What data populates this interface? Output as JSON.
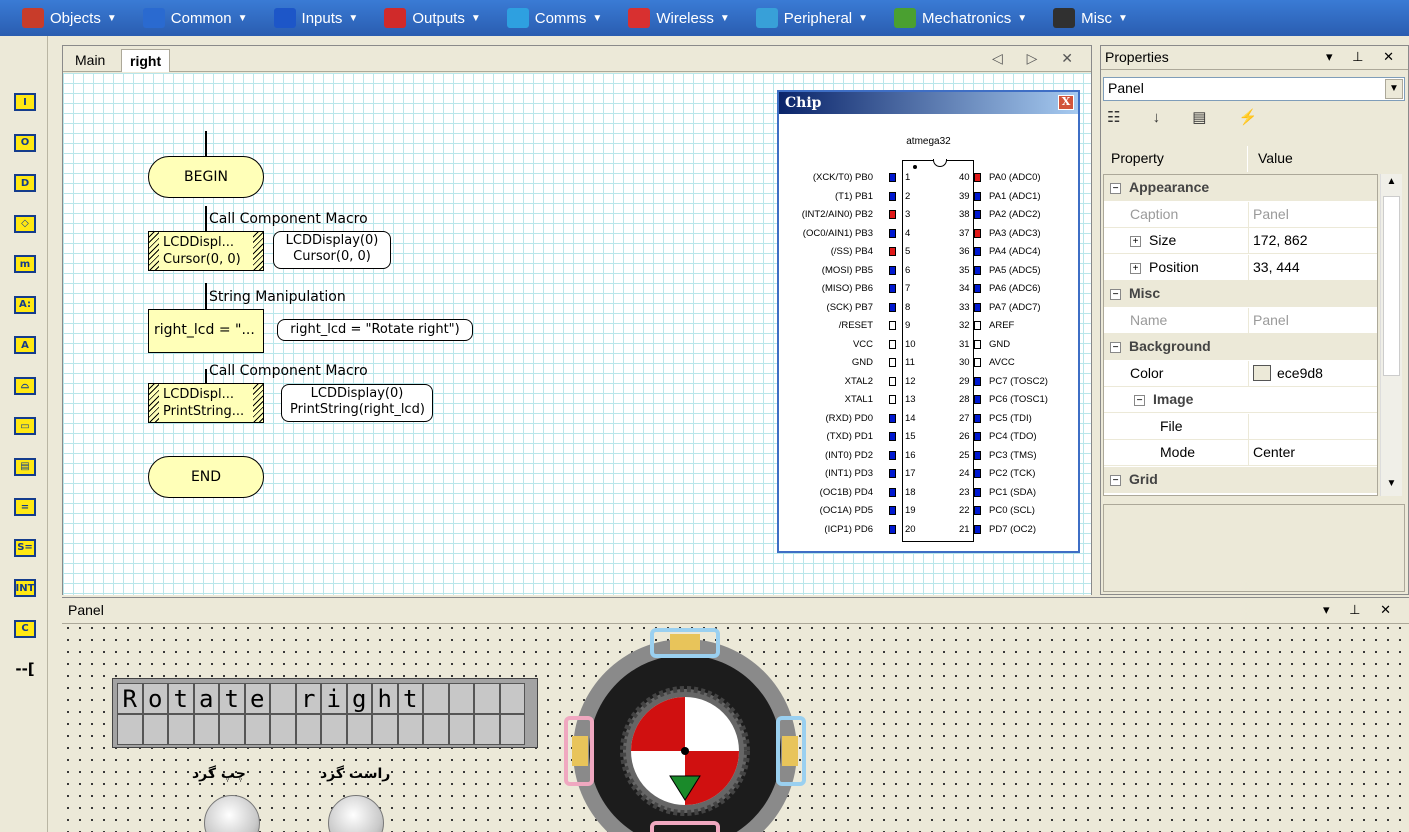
{
  "topbar": {
    "items": [
      {
        "label": "Objects",
        "icon": "objects-icon",
        "color": "#c83c2a"
      },
      {
        "label": "Common",
        "icon": "common-icon",
        "color": "#2a6ad0"
      },
      {
        "label": "Inputs",
        "icon": "inputs-icon",
        "color": "#1d56c8"
      },
      {
        "label": "Outputs",
        "icon": "outputs-icon",
        "color": "#d02a2a"
      },
      {
        "label": "Comms",
        "icon": "comms-icon",
        "color": "#2ea0e0"
      },
      {
        "label": "Wireless",
        "icon": "wireless-icon",
        "color": "#d83030"
      },
      {
        "label": "Peripheral",
        "icon": "peripheral-icon",
        "color": "#38a0d8"
      },
      {
        "label": "Mechatronics",
        "icon": "mechatronics-icon",
        "color": "#4aa030"
      },
      {
        "label": "Misc",
        "icon": "misc-icon",
        "color": "#303030"
      }
    ]
  },
  "toolbox": {
    "items": [
      {
        "name": "input-tool",
        "glyph": "I"
      },
      {
        "name": "output-tool",
        "glyph": "O"
      },
      {
        "name": "delay-tool",
        "glyph": "D"
      },
      {
        "name": "decision-tool",
        "glyph": "◇"
      },
      {
        "name": "switch-tool",
        "glyph": "m"
      },
      {
        "name": "connection-point-tool",
        "glyph": "A:"
      },
      {
        "name": "jump-tool",
        "glyph": "A"
      },
      {
        "name": "loop-tool",
        "glyph": "⌓"
      },
      {
        "name": "macro-tool",
        "glyph": "▭"
      },
      {
        "name": "component-macro-tool",
        "glyph": "▤"
      },
      {
        "name": "calculation-tool",
        "glyph": "="
      },
      {
        "name": "string-tool",
        "glyph": "S="
      },
      {
        "name": "interrupt-tool",
        "glyph": "INT"
      },
      {
        "name": "c-code-tool",
        "glyph": "C"
      },
      {
        "name": "comment-tool",
        "glyph": "--["
      }
    ]
  },
  "doc": {
    "tabs": [
      "Main",
      "right"
    ],
    "active_tab": "right",
    "nav": "◁ ▷ ✕"
  },
  "flow": {
    "begin": "BEGIN",
    "end": "END",
    "label1": "Call Component Macro",
    "macro1_line1": "LCDDispl...",
    "macro1_line2": "Cursor(0, 0)",
    "bubble1_line1": "LCDDisplay(0)",
    "bubble1_line2": "Cursor(0, 0)",
    "label2": "String Manipulation",
    "calc": "right_lcd = \"...",
    "bubble2": "right_lcd = \"Rotate right\")",
    "label3": "Call Component Macro",
    "macro2_line1": "LCDDispl...",
    "macro2_line2": "PrintString...",
    "bubble3_line1": "LCDDisplay(0)",
    "bubble3_line2": "PrintString(right_lcd)"
  },
  "chip": {
    "title": "Chip",
    "close": "X",
    "name": "atmega32",
    "left_pins": [
      {
        "n": "1",
        "label": "(XCK/T0) PB0",
        "color": "#0018d0"
      },
      {
        "n": "2",
        "label": "(T1) PB1",
        "color": "#0018d0"
      },
      {
        "n": "3",
        "label": "(INT2/AIN0) PB2",
        "color": "#e01818"
      },
      {
        "n": "4",
        "label": "(OC0/AIN1) PB3",
        "color": "#0018d0"
      },
      {
        "n": "5",
        "label": "(/SS) PB4",
        "color": "#e01818"
      },
      {
        "n": "6",
        "label": "(MOSI) PB5",
        "color": "#0018d0"
      },
      {
        "n": "7",
        "label": "(MISO) PB6",
        "color": "#0018d0"
      },
      {
        "n": "8",
        "label": "(SCK) PB7",
        "color": "#0018d0"
      },
      {
        "n": "9",
        "label": "/RESET",
        "color": ""
      },
      {
        "n": "10",
        "label": "VCC",
        "color": ""
      },
      {
        "n": "11",
        "label": "GND",
        "color": ""
      },
      {
        "n": "12",
        "label": "XTAL2",
        "color": ""
      },
      {
        "n": "13",
        "label": "XTAL1",
        "color": ""
      },
      {
        "n": "14",
        "label": "(RXD) PD0",
        "color": "#0018d0"
      },
      {
        "n": "15",
        "label": "(TXD) PD1",
        "color": "#0018d0"
      },
      {
        "n": "16",
        "label": "(INT0) PD2",
        "color": "#0018d0"
      },
      {
        "n": "17",
        "label": "(INT1) PD3",
        "color": "#0018d0"
      },
      {
        "n": "18",
        "label": "(OC1B) PD4",
        "color": "#0018d0"
      },
      {
        "n": "19",
        "label": "(OC1A) PD5",
        "color": "#0018d0"
      },
      {
        "n": "20",
        "label": "(ICP1) PD6",
        "color": "#0018d0"
      }
    ],
    "right_pins": [
      {
        "n": "40",
        "label": "PA0 (ADC0)",
        "color": "#e01818"
      },
      {
        "n": "39",
        "label": "PA1 (ADC1)",
        "color": "#0018d0"
      },
      {
        "n": "38",
        "label": "PA2 (ADC2)",
        "color": "#0018d0"
      },
      {
        "n": "37",
        "label": "PA3 (ADC3)",
        "color": "#e01818"
      },
      {
        "n": "36",
        "label": "PA4 (ADC4)",
        "color": "#0018d0"
      },
      {
        "n": "35",
        "label": "PA5 (ADC5)",
        "color": "#0018d0"
      },
      {
        "n": "34",
        "label": "PA6 (ADC6)",
        "color": "#0018d0"
      },
      {
        "n": "33",
        "label": "PA7 (ADC7)",
        "color": "#0018d0"
      },
      {
        "n": "32",
        "label": "AREF",
        "color": ""
      },
      {
        "n": "31",
        "label": "GND",
        "color": ""
      },
      {
        "n": "30",
        "label": "AVCC",
        "color": ""
      },
      {
        "n": "29",
        "label": "PC7 (TOSC2)",
        "color": "#0018d0"
      },
      {
        "n": "28",
        "label": "PC6 (TOSC1)",
        "color": "#0018d0"
      },
      {
        "n": "27",
        "label": "PC5 (TDI)",
        "color": "#0018d0"
      },
      {
        "n": "26",
        "label": "PC4 (TDO)",
        "color": "#0018d0"
      },
      {
        "n": "25",
        "label": "PC3 (TMS)",
        "color": "#0018d0"
      },
      {
        "n": "24",
        "label": "PC2 (TCK)",
        "color": "#0018d0"
      },
      {
        "n": "23",
        "label": "PC1 (SDA)",
        "color": "#0018d0"
      },
      {
        "n": "22",
        "label": "PC0 (SCL)",
        "color": "#0018d0"
      },
      {
        "n": "21",
        "label": "PD7 (OC2)",
        "color": "#0018d0"
      }
    ]
  },
  "props": {
    "title": "Properties",
    "controls": "▾ ⊥ ✕",
    "object": "Panel",
    "toolbar": "☷ ↓ ▤ ⚡",
    "col_property": "Property",
    "col_value": "Value",
    "rows": [
      {
        "kind": "cat",
        "name": "Appearance",
        "sign": "⊟"
      },
      {
        "kind": "ro",
        "name": "Caption",
        "value": "Panel"
      },
      {
        "kind": "exp",
        "name": "Size",
        "value": "172, 862",
        "sign": "⊞"
      },
      {
        "kind": "exp",
        "name": "Position",
        "value": "33, 444",
        "sign": "⊞"
      },
      {
        "kind": "cat",
        "name": "Misc",
        "sign": "⊟"
      },
      {
        "kind": "ro",
        "name": "Name",
        "value": "Panel"
      },
      {
        "kind": "cat",
        "name": "Background",
        "sign": "⊟"
      },
      {
        "kind": "color",
        "name": "Color",
        "value": "ece9d8"
      },
      {
        "kind": "sub",
        "name": "Image",
        "sign": "⊟"
      },
      {
        "kind": "leaf",
        "name": "File",
        "value": ""
      },
      {
        "kind": "leaf",
        "name": "Mode",
        "value": "Center"
      },
      {
        "kind": "cat",
        "name": "Grid",
        "sign": "⊟"
      }
    ]
  },
  "panel": {
    "title": "Panel",
    "controls": "▾ ⊥ ✕",
    "lcd_row1": "Rotate right",
    "lcd_row2": "",
    "left_button_label": "چپ گرد",
    "right_button_label": "راست گرد"
  }
}
